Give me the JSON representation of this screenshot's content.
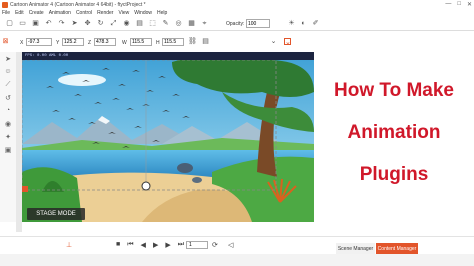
{
  "window": {
    "title": "Cartoon Animator 4 (Cartoon Animator 4 64bit) - ftyctProject *",
    "controls": [
      "—",
      "□",
      "✕"
    ]
  },
  "menu": [
    "File",
    "Edit",
    "Create",
    "Animation",
    "Control",
    "Render",
    "View",
    "Window",
    "Help"
  ],
  "toolbar": {
    "opacity_label": "Opacity:",
    "opacity_value": "100",
    "icons": [
      "new-file-icon",
      "open-folder-icon",
      "save-icon",
      "undo-icon",
      "redo-icon",
      "select-icon",
      "move-icon",
      "rotate-icon",
      "scale-icon",
      "camera-icon",
      "render-icon",
      "transform-icon",
      "pen-icon",
      "eye-icon",
      "grid-icon",
      "snap-icon",
      "light-icon",
      "color-icon",
      "brush-icon"
    ]
  },
  "transform": {
    "x_label": "X",
    "x_value": "-97.3",
    "y_label": "Y",
    "y_value": "125.2",
    "z_label": "Z",
    "z_value": "478.3",
    "w_label": "W",
    "w_value": "115.5",
    "h_label": "H",
    "h_value": "115.5"
  },
  "stage": {
    "status": "FPS: 0.00  AML 0.00",
    "mode_label": "STAGE MODE"
  },
  "overlay_title": {
    "line1": "How To Make",
    "line2": "Animation",
    "line3": "Plugins"
  },
  "playback": {
    "frame": "1",
    "buttons": [
      "stop-icon",
      "prev-key-icon",
      "prev-frame-icon",
      "play-icon",
      "next-frame-icon",
      "next-key-icon",
      "loop-icon"
    ]
  },
  "tabs": {
    "scene_manager": "Scene Manager",
    "content_manager": "Content Manager"
  },
  "colors": {
    "accent": "#e2552b",
    "title_red": "#d0182a",
    "stage_bar": "#1c2440",
    "sky": "#8fd3f0",
    "water": "#3fa6d8",
    "grass": "#5db548",
    "sand": "#e8c98a"
  }
}
